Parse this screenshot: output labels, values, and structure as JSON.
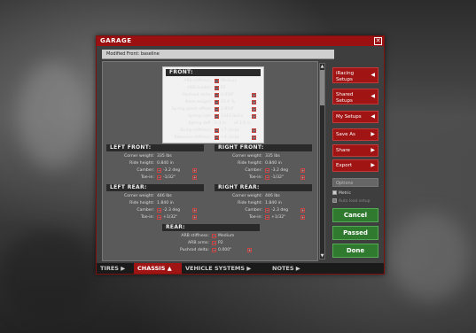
{
  "window": {
    "title": "GARAGE",
    "close_glyph": "✕"
  },
  "setup_name": "Modified Front: baseline",
  "front": {
    "header": "FRONT:",
    "rows": [
      {
        "label": "ARB stiffness:",
        "value": "Medium"
      },
      {
        "label": "ARB blades:",
        "value": "P2"
      },
      {
        "label": "Pushrod delta:",
        "value": "0.039\""
      },
      {
        "label": "Nose weight:",
        "value": "43.0 %"
      },
      {
        "label": "Spring perch offset:",
        "value": "2.854\""
      },
      {
        "label": "Spring rate:",
        "value": "1343 lbs/in"
      },
      {
        "label": "Spring defl:",
        "value": "0.3 in",
        "extra": "of  2.9 in"
      },
      {
        "label": "Bump stiffness:",
        "value": "+7 clicks"
      },
      {
        "label": "Rebound stiffness:",
        "value": "+4 clicks"
      }
    ]
  },
  "left_front": {
    "header": "LEFT FRONT:",
    "rows": [
      {
        "label": "Corner weight:",
        "value": "335 lbs"
      },
      {
        "label": "Ride height:",
        "value": "0.840 in"
      },
      {
        "label": "Camber:",
        "value": "-3.2 deg"
      },
      {
        "label": "Toe-in:",
        "value": "-1/32\""
      }
    ]
  },
  "right_front": {
    "header": "RIGHT FRONT:",
    "rows": [
      {
        "label": "Corner weight:",
        "value": "335 lbs"
      },
      {
        "label": "Ride height:",
        "value": "0.840 in"
      },
      {
        "label": "Camber:",
        "value": "-3.2 deg"
      },
      {
        "label": "Toe-in:",
        "value": "-1/32\""
      }
    ]
  },
  "left_rear": {
    "header": "LEFT REAR:",
    "rows": [
      {
        "label": "Corner weight:",
        "value": "446 lbs"
      },
      {
        "label": "Ride height:",
        "value": "1.840 in"
      },
      {
        "label": "Camber:",
        "value": "-2.3 deg"
      },
      {
        "label": "Toe-in:",
        "value": "+1/32\""
      }
    ]
  },
  "right_rear": {
    "header": "RIGHT REAR:",
    "rows": [
      {
        "label": "Corner weight:",
        "value": "446 lbs"
      },
      {
        "label": "Ride height:",
        "value": "1.840 in"
      },
      {
        "label": "Camber:",
        "value": "-2.3 deg"
      },
      {
        "label": "Toe-in:",
        "value": "+1/32\""
      }
    ]
  },
  "rear": {
    "header": "REAR:",
    "rows": [
      {
        "label": "ARB stiffness:",
        "value": "Medium"
      },
      {
        "label": "ARB arms:",
        "value": "P2"
      },
      {
        "label": "Pushrod delta:",
        "value": "0.000\""
      }
    ]
  },
  "side_buttons": [
    {
      "label_1": "iRacing",
      "label_2": "Setups",
      "arrow": "◀"
    },
    {
      "label_1": "Shared",
      "label_2": "Setups",
      "arrow": "◀"
    },
    {
      "label_1": "My Setups",
      "label_2": "",
      "arrow": "◀"
    },
    {
      "label_1": "Save As",
      "label_2": "",
      "arrow": "▶"
    },
    {
      "label_1": "Share",
      "label_2": "",
      "arrow": "▶"
    },
    {
      "label_1": "Export",
      "label_2": "",
      "arrow": "▶"
    }
  ],
  "options_label": "Options",
  "checkboxes": [
    {
      "label": "Metric"
    },
    {
      "label": "Auto load setup"
    }
  ],
  "actions": {
    "cancel": "Cancel",
    "passed": "Passed",
    "done": "Done"
  },
  "tabs": [
    {
      "label": "TIRES",
      "arrow": "▶"
    },
    {
      "label": "CHASSIS",
      "arrow": "▲"
    },
    {
      "label": "VEHICLE SYSTEMS",
      "arrow": "▶"
    },
    {
      "label": "NOTES",
      "arrow": "▶"
    }
  ],
  "colors": {
    "accent_red": "#a01414",
    "green": "#2f7a2f"
  }
}
